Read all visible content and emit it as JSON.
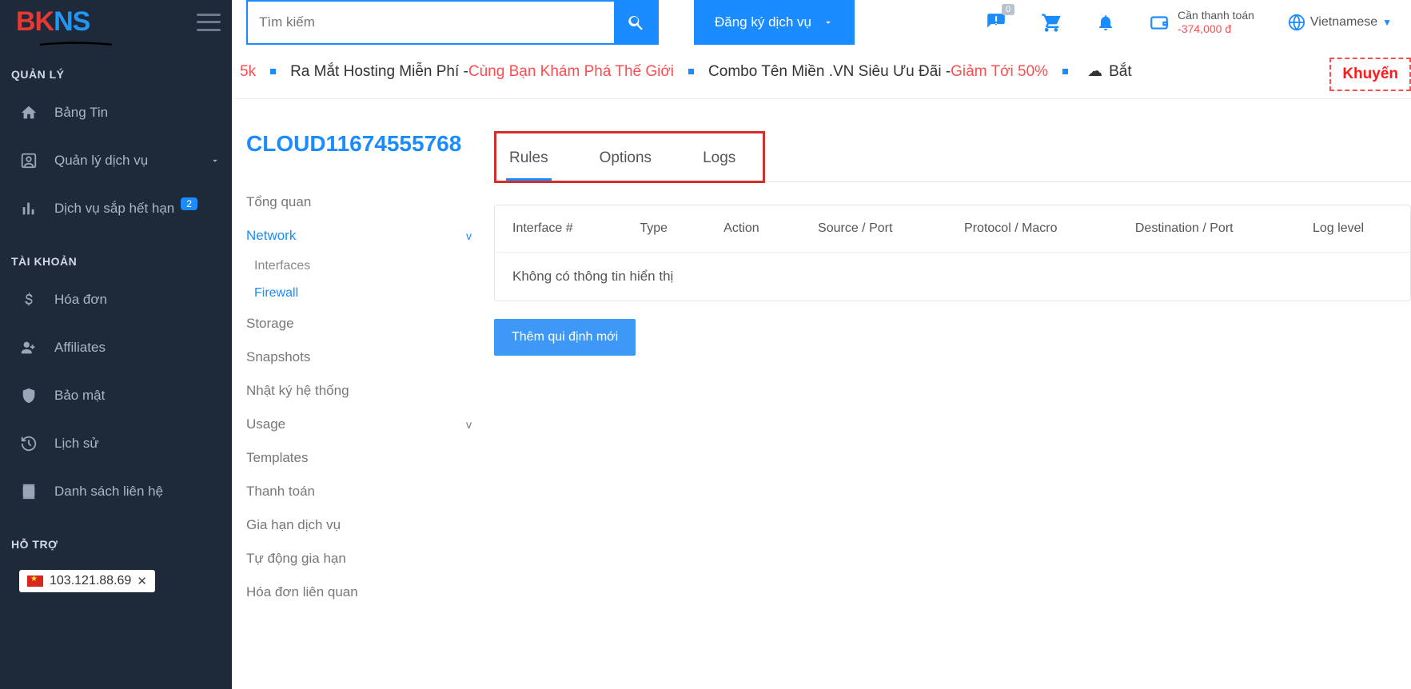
{
  "logo": {
    "part1": "BK",
    "part2": "NS"
  },
  "sidebar": {
    "section1": "QUẢN LÝ",
    "items1": [
      {
        "label": "Bảng Tin"
      },
      {
        "label": "Quản lý dịch vụ"
      },
      {
        "label": "Dịch vụ sắp hết hạn",
        "badge": "2"
      }
    ],
    "section2": "TÀI KHOẢN",
    "items2": [
      {
        "label": "Hóa đơn"
      },
      {
        "label": "Affiliates"
      },
      {
        "label": "Bảo mật"
      },
      {
        "label": "Lịch sử"
      },
      {
        "label": "Danh sách liên hệ"
      }
    ],
    "section3": "HỖ TRỢ",
    "ip": "103.121.88.69"
  },
  "header": {
    "search_placeholder": "Tìm kiếm",
    "register": "Đăng ký dịch vụ",
    "notif_count": "0",
    "balance_label": "Cần thanh toán",
    "balance_amount": "-374,000 đ",
    "language": "Vietnamese"
  },
  "ticker": {
    "t0": "5k",
    "t1": "Ra Mắt Hosting Miễn Phí - ",
    "t1b": "Cùng Bạn Khám Phá Thế Giới",
    "t2": "Combo Tên Miền .VN Siêu Ưu Đãi - ",
    "t2b": "Giảm Tới 50%",
    "t3": "Bắt",
    "promo": "Khuyến"
  },
  "page": {
    "title": "CLOUD11674555768",
    "side_items": [
      {
        "label": "Tổng quan"
      },
      {
        "label": "Network",
        "active": true,
        "expand": "v",
        "sub": [
          {
            "label": "Interfaces"
          },
          {
            "label": "Firewall",
            "active": true
          }
        ]
      },
      {
        "label": "Storage"
      },
      {
        "label": "Snapshots"
      },
      {
        "label": "Nhật ký hệ thống"
      },
      {
        "label": "Usage",
        "expand": "v"
      },
      {
        "label": "Templates"
      },
      {
        "label": "Thanh toán"
      },
      {
        "label": "Gia hạn dịch vụ"
      },
      {
        "label": "Tự động gia hạn"
      },
      {
        "label": "Hóa đơn liên quan"
      }
    ],
    "tabs": [
      "Rules",
      "Options",
      "Logs"
    ],
    "table_headers": [
      "Interface #",
      "Type",
      "Action",
      "Source / Port",
      "Protocol / Macro",
      "Destination / Port",
      "Log level"
    ],
    "empty": "Không có thông tin hiển thị",
    "add_button": "Thêm qui định mới"
  }
}
